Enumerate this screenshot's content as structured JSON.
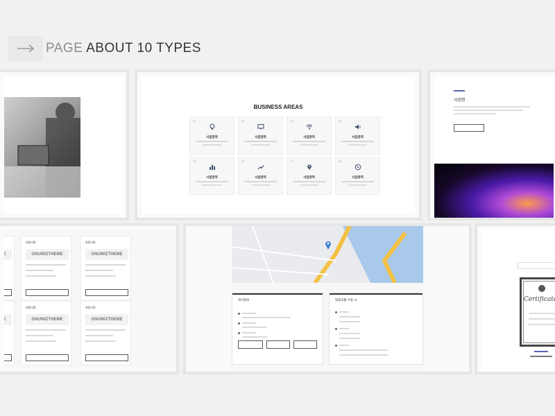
{
  "header": {
    "title_light": "PAGE ",
    "title_dark": "ABOUT 10 TYPES",
    "arrow_icon": "arrow-right-icon"
  },
  "business": {
    "title": "BUSINESS AREAS",
    "cells": [
      {
        "num": "01",
        "name": "사업영역",
        "icon": "lightbulb-icon"
      },
      {
        "num": "02",
        "name": "사업영역",
        "icon": "monitor-icon"
      },
      {
        "num": "03",
        "name": "사업영역",
        "icon": "wifi-icon"
      },
      {
        "num": "04",
        "name": "사업영역",
        "icon": "speaker-icon"
      },
      {
        "num": "05",
        "name": "사업영역",
        "icon": "bar-chart-icon"
      },
      {
        "num": "06",
        "name": "사업영역",
        "icon": "trend-icon"
      },
      {
        "num": "07",
        "name": "사업영역",
        "icon": "map-pin-icon"
      },
      {
        "num": "08",
        "name": "사업영역",
        "icon": "compass-icon"
      }
    ]
  },
  "about": {
    "heading": "사업명"
  },
  "contact": {
    "title": "회원사명",
    "logo": "GNUWIZTHEME"
  },
  "company": {
    "panel_left_title": "회사정보",
    "panel_right_title": "대중교통 이용 시"
  },
  "colors": {
    "accent": "#5866b6",
    "page_bg": "#f1f1f1"
  }
}
